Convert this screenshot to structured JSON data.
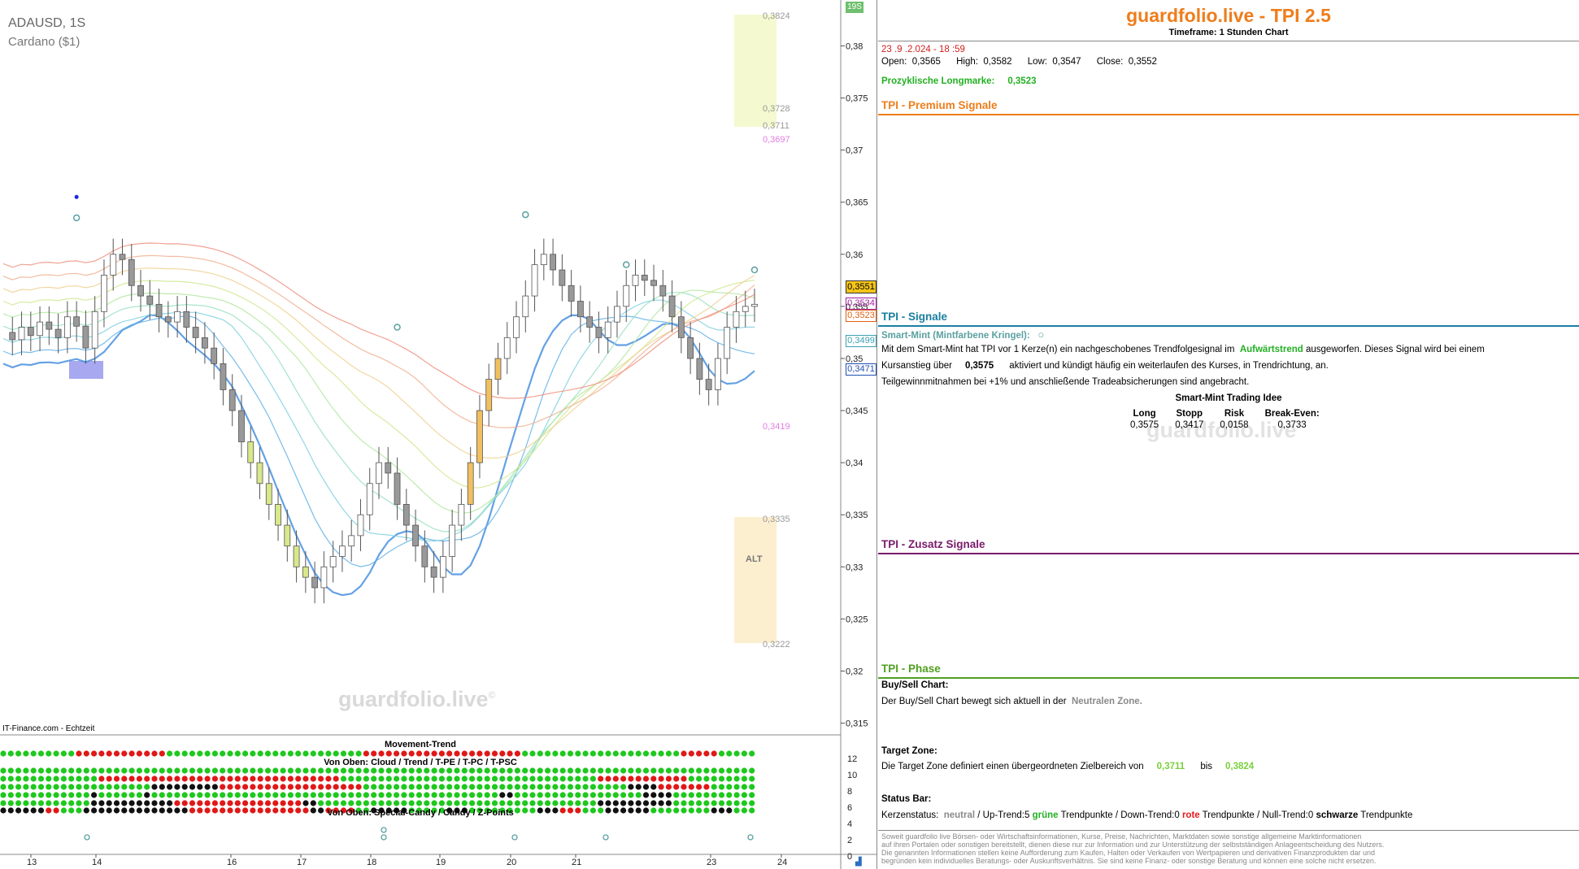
{
  "chart_header": {
    "symbol": "ADAUSD, 1S",
    "name": "Cardano ($1)",
    "timeframe_badge": "19S"
  },
  "watermark": "guardfolio.live",
  "watermark_mark": "©",
  "source_label": "IT-Finance.com - Echtzeit",
  "alt_label": "ALT",
  "price_badges": [
    "0,3551",
    "0,3534",
    "0,3523",
    "0,3499",
    "0,3471"
  ],
  "levels": [
    "0,3824",
    "0,3728",
    "0,3711",
    "0,3697",
    "0,3419",
    "0,3335",
    "0,3222"
  ],
  "indicator": {
    "title1": "Movement-Trend",
    "title2": "Von Oben: Cloud / Trend / T-PE / T-PC / T-PSC",
    "title3": "Von Oben: Special-Candy / Candy / Z-Points",
    "y_ticks": [
      "12",
      "10",
      "8",
      "6",
      "4",
      "2",
      "0"
    ]
  },
  "colors": {
    "bull": "#1ec81e",
    "bear": "#e01818",
    "neutral": "#111111",
    "accent": "#ee7d1b",
    "mint": "#5aa0a0"
  },
  "chart_data": {
    "type": "candlestick",
    "y_ticks": [
      "0,38",
      "0,375",
      "0,37",
      "0,365",
      "0,36",
      "0,355",
      "0,35",
      "0,345",
      "0,34",
      "0,335",
      "0,33",
      "0,325",
      "0,32",
      "0,315"
    ],
    "ylim": [
      0.3145,
      0.383
    ],
    "x_ticks": [
      "13",
      "14",
      "16",
      "17",
      "18",
      "19",
      "20",
      "21",
      "23",
      "24"
    ],
    "close_series": [
      0.3525,
      0.3518,
      0.353,
      0.3522,
      0.3535,
      0.3528,
      0.352,
      0.354,
      0.3531,
      0.351,
      0.3545,
      0.358,
      0.36,
      0.3595,
      0.357,
      0.356,
      0.3552,
      0.354,
      0.3535,
      0.3545,
      0.353,
      0.352,
      0.351,
      0.3495,
      0.347,
      0.345,
      0.342,
      0.34,
      0.338,
      0.336,
      0.334,
      0.332,
      0.33,
      0.329,
      0.328,
      0.33,
      0.331,
      0.332,
      0.333,
      0.335,
      0.338,
      0.34,
      0.339,
      0.336,
      0.334,
      0.332,
      0.33,
      0.329,
      0.331,
      0.334,
      0.336,
      0.34,
      0.345,
      0.348,
      0.35,
      0.352,
      0.354,
      0.356,
      0.359,
      0.36,
      0.3585,
      0.357,
      0.3555,
      0.354,
      0.353,
      0.352,
      0.3535,
      0.355,
      0.357,
      0.358,
      0.3575,
      0.357,
      0.356,
      0.354,
      0.352,
      0.35,
      0.348,
      0.347,
      0.35,
      0.353,
      0.3545,
      0.355,
      0.3552
    ],
    "signals": {
      "open": "0,3565",
      "high": "0,3582",
      "low": "0,3547",
      "close": "0,3552"
    }
  },
  "panel": {
    "title": "guardfolio.live - TPI 2.5",
    "timeframe": "Timeframe: 1 Stunden Chart",
    "datetime": "23 .9 .2.024 - 18 :59",
    "ohlc": {
      "open_label": "Open:",
      "open": "0,3565",
      "high_label": "High:",
      "high": "0,3582",
      "low_label": "Low:",
      "low": "0,3547",
      "close_label": "Close:",
      "close": "0,3552"
    },
    "longmarke_label": "Prozyklische Longmarke:",
    "longmarke_value": "0,3523",
    "premium_title": "TPI - Premium Signale",
    "signale_title": "TPI - Signale",
    "smart_mint_label": "Smart-Mint (Mintfarbene Kringel):",
    "sm_line1_a": "Mit dem Smart-Mint hat TPI vor 1  Kerze(n) ein nachgeschobenes Trendfolgesignal im",
    "sm_line1_b": "Aufwärtstrend",
    "sm_line1_c": "ausgeworfen. Dieses Signal wird bei einem",
    "sm_line2_a": "Kursanstieg über",
    "sm_line2_b": "0,3575",
    "sm_line2_c": "aktiviert und kündigt häufig ein weiterlaufen des Kurses, in Trendrichtung, an.",
    "sm_line3": "Teilgewinnmitnahmen bei +1% und anschließende Tradeabsicherungen sind angebracht.",
    "idea_title": "Smart-Mint Trading Idee",
    "idea_headers": [
      "Long",
      "Stopp",
      "Risk",
      "Break-Even:"
    ],
    "idea_values": [
      "0,3575",
      "0,3417",
      "0,0158",
      "0,3733"
    ],
    "zusatz_title": "TPI - Zusatz Signale",
    "phase_title": "TPI - Phase",
    "buysell_label": "Buy/Sell Chart:",
    "buysell_text": "Der Buy/Sell Chart bewegt sich aktuell in der",
    "buysell_zone": "Neutralen Zone.",
    "target_label": "Target Zone:",
    "target_text": "Die Target Zone definiert einen übergeordneten Zielbereich von",
    "target_low": "0,3711",
    "target_bis": "bis",
    "target_high": "0,3824",
    "status_label": "Status Bar:",
    "status_a": "Kerzenstatus:",
    "status_neutral": "neutral",
    "status_b": "/ Up-Trend:5",
    "status_gruene": "grüne",
    "status_c": "Trendpunkte  / Down-Trend:0",
    "status_rote": "rote",
    "status_d": "Trendpunkte / Null-Trend:0",
    "status_schwarze": "schwarze",
    "status_e": "Trendpunkte",
    "disclaimer": [
      "Soweit guardfolio live Börsen- oder Wirtschaftsinformationen, Kurse, Preise, Nachrichten, Marktdaten sowie sonstige allgemeine Marktinformationen",
      "auf ihren Portalen oder sonstigen bereitstellt, dienen diese nur zur Information und zur Unterstützung der selbstständigen Anlageentscheidung des Nutzers.",
      "Die genannten Informationen stellen keine Aufforderung zum Kaufen, Halten oder Verkaufen von Wertpapieren und derivativen Finanzprodukten dar und",
      "begründen kein individuelles Beratungs- oder Auskunftsverhältnis. Sie sind keine Finanz- oder sonstige Beratung und können eine solche nicht ersetzen."
    ]
  }
}
